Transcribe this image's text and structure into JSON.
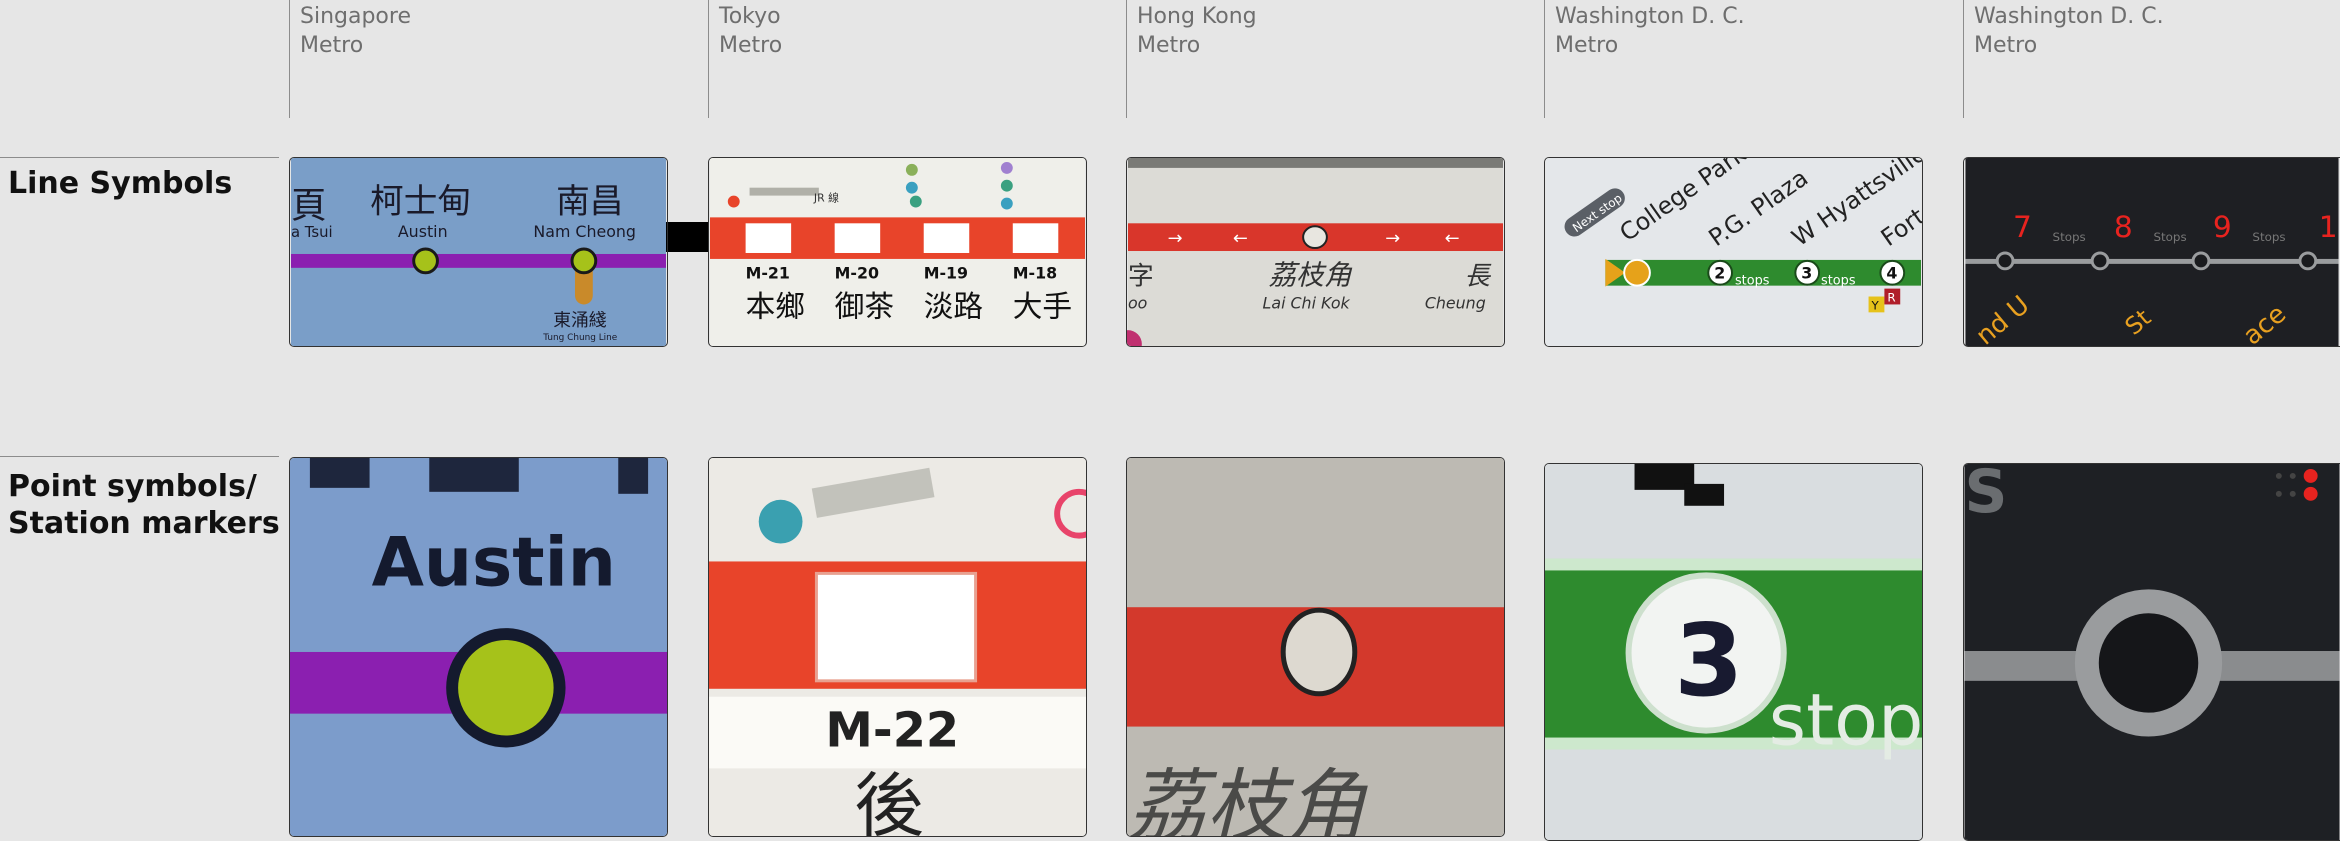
{
  "columns": [
    {
      "city": "Singapore",
      "kind": "Metro"
    },
    {
      "city": "Tokyo",
      "kind": "Metro"
    },
    {
      "city": "Hong Kong",
      "kind": "Metro"
    },
    {
      "city": "Washington D. C.",
      "kind": "Metro"
    },
    {
      "city": "Washington D. C.",
      "kind": "Metro"
    }
  ],
  "rows": [
    {
      "label": "Line Symbols"
    },
    {
      "label_line1": "Point symbols/",
      "label_line2": "Station markers"
    }
  ],
  "tiles": {
    "singapore_line": {
      "ch1": "柯士甸",
      "en1": "Austin",
      "ch2": "南昌",
      "en2": "Nam Cheong",
      "ch0": "頁",
      "en0": "a Tsui",
      "branch_ch": "東涌綫",
      "branch_en": "Tung Chung Line"
    },
    "tokyo_line": {
      "codes": [
        "M-21",
        "M-20",
        "M-19",
        "M-18"
      ],
      "names": [
        "本鄉",
        "御茶",
        "淡路",
        "大手"
      ],
      "jr": "JR 線"
    },
    "hongkong_line": {
      "ch": "荔枝角",
      "en": "Lai Chi Kok",
      "en_right": "Cheung",
      "ch_left": "字",
      "en_left": "oo",
      "ch_right": "長"
    },
    "dc_line": {
      "next": "Next stop",
      "s1": "College Park",
      "s2": "P.G. Plaza",
      "s3": "W Hyattsville",
      "s4": "Fort",
      "n2": "2",
      "n3": "3",
      "n4": "4",
      "stops": "stops",
      "y": "Y",
      "r": "R"
    },
    "dc_led": {
      "n1": "7",
      "n2": "8",
      "n3": "9",
      "n4": "1",
      "stops": "Stops",
      "d1": "nd U",
      "d2": "St",
      "d3": "ace"
    },
    "singapore_point": {
      "en": "Austin"
    },
    "tokyo_point": {
      "code": "M-22",
      "ch": "後"
    },
    "hongkong_point": {
      "ch": "荔枝角"
    },
    "dc_point": {
      "num": "3",
      "stop": "stop"
    },
    "dc_led_point": {
      "s": "S"
    }
  },
  "colors": {
    "background": "#e6e6e6",
    "singapore_purple": "#8b1fb0",
    "singapore_marker": "#a6c21a",
    "tokyo_red": "#e8442a",
    "hongkong_red": "#d9362b",
    "dc_green": "#2e8b2e",
    "dc_orange": "#e6a21a",
    "led_red": "#e8231f"
  }
}
